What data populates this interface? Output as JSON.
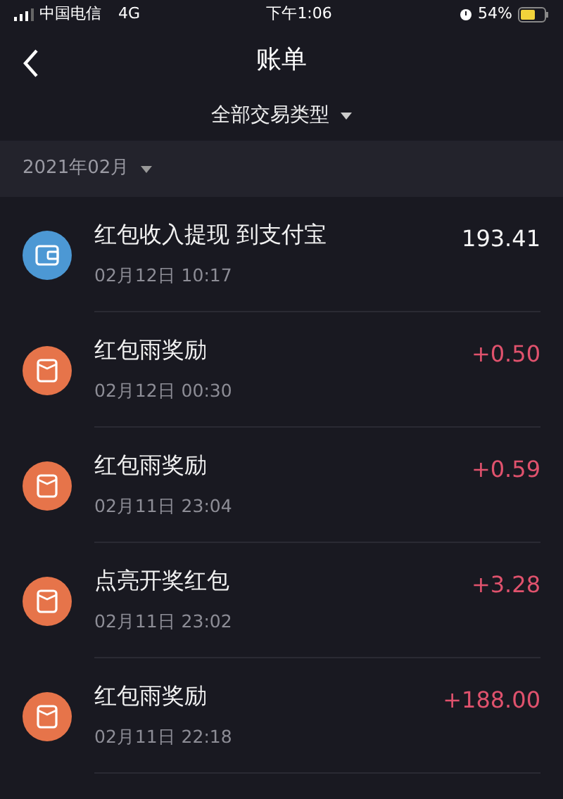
{
  "status_bar": {
    "carrier": "中国电信",
    "network": "4G",
    "time": "下午1:06",
    "battery": "54%"
  },
  "nav": {
    "title": "账单"
  },
  "filter": {
    "label": "全部交易类型"
  },
  "month": {
    "label": "2021年02月"
  },
  "transactions": [
    {
      "kind": "wallet",
      "title": "红包收入提现 到支付宝",
      "time": "02月12日 10:17",
      "amount": "193.41",
      "income": false
    },
    {
      "kind": "redpacket",
      "title": "红包雨奖励",
      "time": "02月12日 00:30",
      "amount": "+0.50",
      "income": true
    },
    {
      "kind": "redpacket",
      "title": "红包雨奖励",
      "time": "02月11日 23:04",
      "amount": "+0.59",
      "income": true
    },
    {
      "kind": "redpacket",
      "title": "点亮开奖红包",
      "time": "02月11日 23:02",
      "amount": "+3.28",
      "income": true
    },
    {
      "kind": "redpacket",
      "title": "红包雨奖励",
      "time": "02月11日 22:18",
      "amount": "+188.00",
      "income": true
    }
  ]
}
